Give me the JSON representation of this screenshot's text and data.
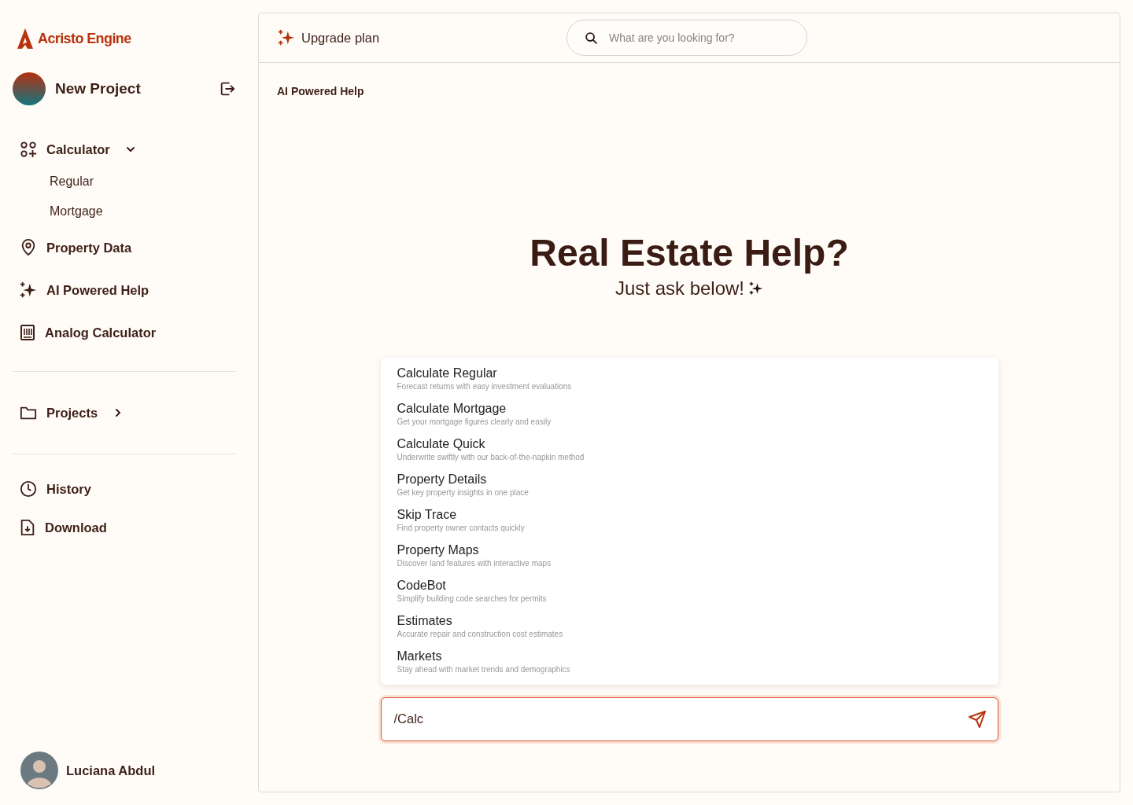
{
  "logo": {
    "name": "Acristo Engine"
  },
  "project": {
    "name": "New Project"
  },
  "nav": [
    {
      "label": "Calculator",
      "expanded": true,
      "children": [
        {
          "label": "Regular"
        },
        {
          "label": "Mortgage"
        }
      ]
    },
    {
      "label": "Property Data"
    },
    {
      "label": "AI Powered Help"
    },
    {
      "label": "Analog Calculator"
    }
  ],
  "projects": {
    "label": "Projects",
    "expanded": false
  },
  "nav_bottom": [
    {
      "label": "History"
    },
    {
      "label": "Download"
    }
  ],
  "user": {
    "name": "Luciana Abdul"
  },
  "topbar": {
    "upgrade": "Upgrade plan",
    "search": {
      "placeholder": "What are you looking for?"
    }
  },
  "breadcrumb": "AI Powered Help",
  "hero": {
    "title": "Real Estate Help?",
    "subtitle": "Just ask below!"
  },
  "suggestions": [
    {
      "title": "Calculate Regular",
      "description": "Forecast returns with easy investment evaluations"
    },
    {
      "title": "Calculate Mortgage",
      "description": "Get your mortgage figures clearly and easily"
    },
    {
      "title": "Calculate Quick",
      "description": "Underwrite swiftly with our back-of-the-napkin method"
    },
    {
      "title": "Property Details",
      "description": "Get key property insights in one place"
    },
    {
      "title": "Skip Trace",
      "description": "Find property owner contacts quickly"
    },
    {
      "title": "Property Maps",
      "description": "Discover land features with interactive maps"
    },
    {
      "title": "CodeBot",
      "description": "Simplify building code searches for permits"
    },
    {
      "title": "Estimates",
      "description": "Accurate repair and construction cost estimates"
    },
    {
      "title": "Markets",
      "description": "Stay ahead with market trends and demographics"
    }
  ],
  "composer": {
    "value": "/Calc"
  }
}
